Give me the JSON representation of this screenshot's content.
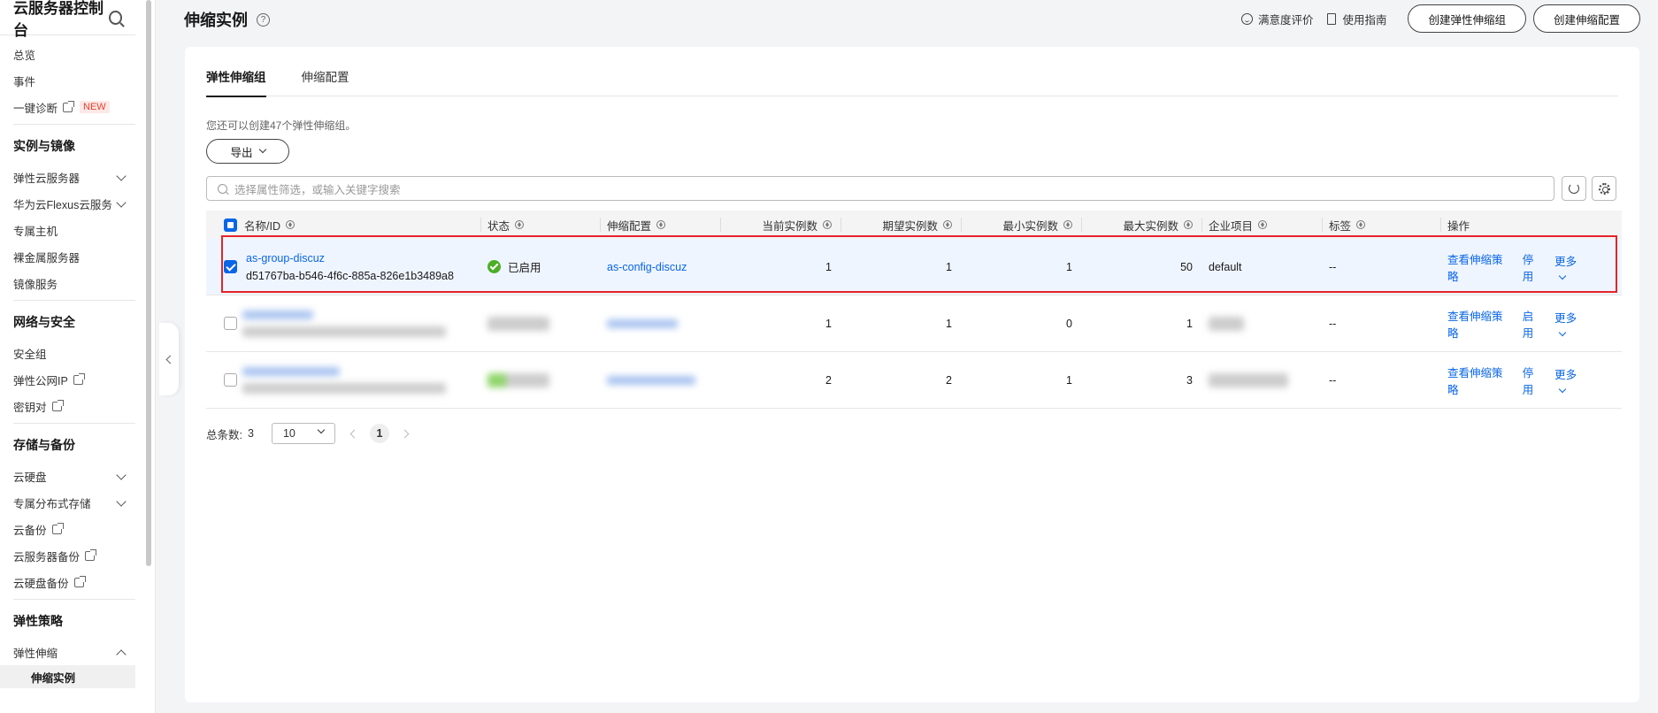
{
  "sidebar": {
    "title": "云服务器控制台",
    "items_top": [
      {
        "label": "总览"
      },
      {
        "label": "事件"
      },
      {
        "label": "一键诊断",
        "badge": "NEW"
      }
    ],
    "sections": [
      {
        "title": "实例与镜像",
        "items": [
          "弹性云服务器",
          "华为云Flexus云服务",
          "专属主机",
          "裸金属服务器",
          "镜像服务"
        ]
      },
      {
        "title": "网络与安全",
        "items": [
          "安全组",
          "弹性公网IP",
          "密钥对"
        ]
      },
      {
        "title": "存储与备份",
        "items": [
          "云硬盘",
          "专属分布式存储",
          "云备份",
          "云服务器备份",
          "云硬盘备份"
        ]
      },
      {
        "title": "弹性策略",
        "items": [
          "弹性伸缩",
          "伸缩实例"
        ]
      }
    ]
  },
  "header": {
    "title": "伸缩实例",
    "help": "?",
    "feedback": "满意度评价",
    "guide": "使用指南",
    "create_group": "创建弹性伸缩组",
    "create_config": "创建伸缩配置"
  },
  "tabs": [
    "弹性伸缩组",
    "伸缩配置"
  ],
  "hint": "您还可以创建47个弹性伸缩组。",
  "export_label": "导出",
  "search_placeholder": "选择属性筛选，或输入关键字搜索",
  "table": {
    "headers": [
      "名称/ID",
      "状态",
      "伸缩配置",
      "当前实例数",
      "期望实例数",
      "最小实例数",
      "最大实例数",
      "企业项目",
      "标签",
      "操作"
    ],
    "rows": [
      {
        "name": "as-group-discuz",
        "id": "d51767ba-b546-4f6c-885a-826e1b3489a8",
        "status": "已启用",
        "config": "as-config-discuz",
        "current": "1",
        "desired": "1",
        "min": "1",
        "max": "50",
        "project": "default",
        "tags": "--",
        "op1": "查看伸缩策略",
        "op2": "停用",
        "op3": "更多"
      },
      {
        "current": "1",
        "desired": "1",
        "min": "0",
        "max": "1",
        "tags": "--",
        "op1": "查看伸缩策略",
        "op2": "启用",
        "op3": "更多"
      },
      {
        "current": "2",
        "desired": "2",
        "min": "1",
        "max": "3",
        "tags": "--",
        "op1": "查看伸缩策略",
        "op2": "停用",
        "op3": "更多"
      }
    ]
  },
  "pager": {
    "total_label": "总条数:",
    "total": "3",
    "page_size": "10",
    "page": "1"
  },
  "colors": {
    "accent": "#0a66e6",
    "highlight": "#e5232b",
    "success": "#4cae26"
  }
}
